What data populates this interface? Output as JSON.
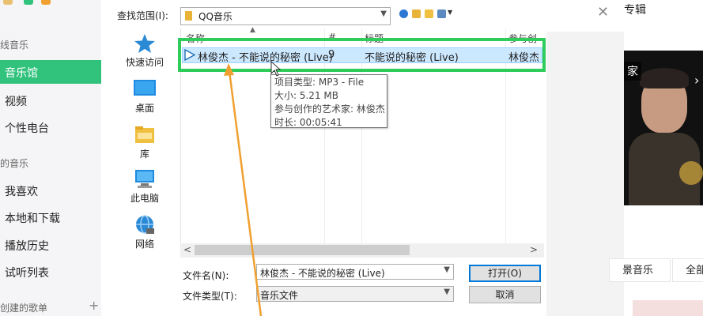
{
  "app": {
    "sidebar": {
      "section_online": "线音乐",
      "active_item": "音乐馆",
      "items_online": [
        "视频",
        "个性电台"
      ],
      "section_mine": "的音乐",
      "items_mine": [
        "我喜欢",
        "本地和下载",
        "播放历史",
        "试听列表"
      ],
      "section_created": "创建的歌单",
      "add_symbol": "+"
    },
    "right_panel": {
      "album_label": "专辑",
      "close_symbol": "✕",
      "photo_tag": "家",
      "photo_arrow": "›",
      "pill_left": "景音乐",
      "pill_right": "全部"
    }
  },
  "dialog": {
    "lookin_label": "查找范围(I):",
    "lookin_value": "QQ音乐",
    "places": [
      "快速访问",
      "桌面",
      "库",
      "此电脑",
      "网络"
    ],
    "columns": [
      "名称",
      "#",
      "标题",
      "参与创"
    ],
    "file_row": {
      "name": "林俊杰 - 不能说的秘密 (Live)",
      "track": "9",
      "title": "不能说的秘密 (Live)",
      "artist": "林俊杰"
    },
    "tooltip": [
      "项目类型: MP3 - File",
      "大小: 5.21 MB",
      "参与创作的艺术家: 林俊杰",
      "时长: 00:05:41"
    ],
    "filename_label": "文件名(N):",
    "filename_value": "林俊杰 - 不能说的秘密 (Live)",
    "filetype_label": "文件类型(T):",
    "filetype_value": "音乐文件",
    "open_button": "打开(O)",
    "cancel_button": "取消",
    "scroll_left": "<",
    "scroll_right": ">"
  },
  "colors": {
    "accent_green": "#31c27c",
    "highlight_green": "#2ecc5a",
    "annotation_orange": "#f0a030",
    "selection_blue": "#cce8ff"
  }
}
